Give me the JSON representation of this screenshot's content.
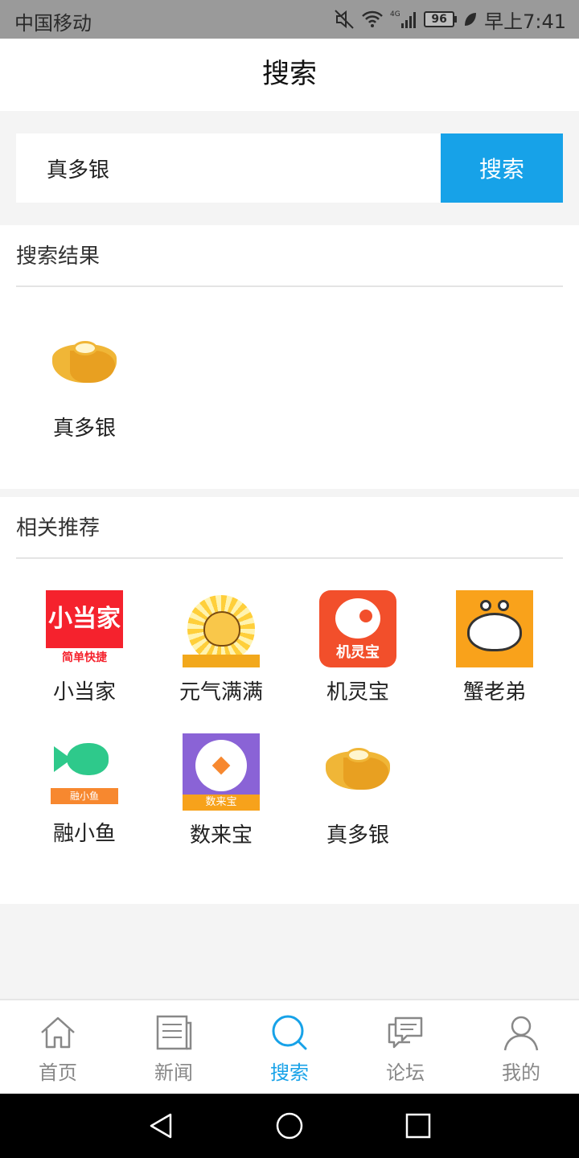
{
  "status_bar": {
    "carrier": "中国移动",
    "battery": "96",
    "time": "早上7:41",
    "network": "4G"
  },
  "header": {
    "title": "搜索"
  },
  "search": {
    "value": "真多银",
    "button_label": "搜索"
  },
  "results": {
    "title": "搜索结果",
    "items": [
      {
        "name": "真多银",
        "icon": "ingot-icon"
      }
    ]
  },
  "recommend": {
    "title": "相关推荐",
    "items": [
      {
        "name": "小当家",
        "icon": "xiaodangjia-icon",
        "icon_text": "小当家",
        "icon_sub": "简单快捷"
      },
      {
        "name": "元气满满",
        "icon": "cartoon-cat-icon"
      },
      {
        "name": "机灵宝",
        "icon": "dog-icon",
        "icon_text": "机灵宝"
      },
      {
        "name": "蟹老弟",
        "icon": "crab-icon"
      },
      {
        "name": "融小鱼",
        "icon": "fish-icon",
        "icon_text": "融小鱼"
      },
      {
        "name": "数来宝",
        "icon": "shulaibao-icon",
        "icon_text": "数来宝"
      },
      {
        "name": "真多银",
        "icon": "ingot-icon"
      }
    ]
  },
  "bottom_nav": {
    "items": [
      {
        "label": "首页",
        "icon": "home-icon"
      },
      {
        "label": "新闻",
        "icon": "news-icon"
      },
      {
        "label": "搜索",
        "icon": "search-icon",
        "active": true
      },
      {
        "label": "论坛",
        "icon": "forum-icon"
      },
      {
        "label": "我的",
        "icon": "user-icon"
      }
    ]
  },
  "colors": {
    "accent": "#17a2e8",
    "status_bar_bg": "#9a9a9a",
    "page_bg": "#f4f4f4"
  }
}
